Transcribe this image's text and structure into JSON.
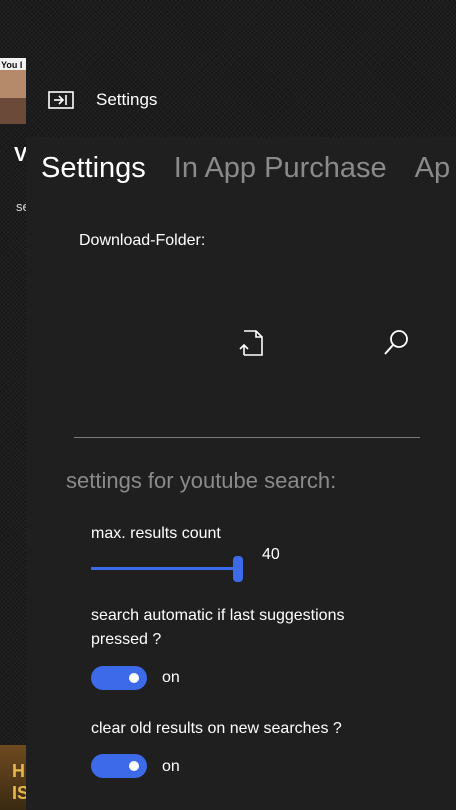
{
  "background": {
    "thumb_text": "You I",
    "letter": "V",
    "small_text": "se",
    "bottom_text": "H IS"
  },
  "topbar": {
    "title": "Settings",
    "icon": "pane-toggle-icon"
  },
  "tabs": [
    {
      "label": "Settings",
      "active": true
    },
    {
      "label": "In App Purchase",
      "active": false
    },
    {
      "label": "Ap",
      "active": false
    }
  ],
  "download": {
    "label": "Download-Folder:",
    "open_icon": "open-folder-icon",
    "search_icon": "search-icon"
  },
  "youtube": {
    "section_title": "settings for youtube search:",
    "max_results_label": "max. results count",
    "max_results_value": "40",
    "auto_search_label_line1": "search automatic if last suggestions",
    "auto_search_label_line2": "pressed ?",
    "auto_search_state": "on",
    "clear_results_label": "clear old results on new searches ?",
    "clear_results_state": "on"
  },
  "colors": {
    "accent": "#3d6ae8",
    "panel": "#1f1f1f",
    "muted_text": "#8a8a8a"
  }
}
